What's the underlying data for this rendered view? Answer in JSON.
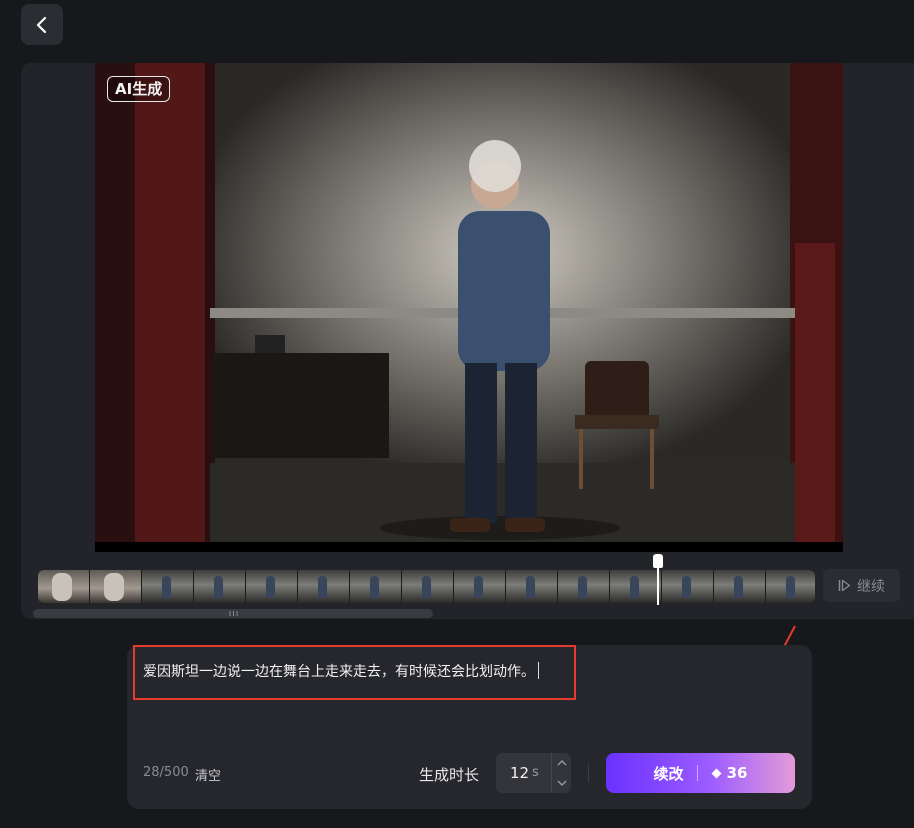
{
  "video": {
    "badge": "AI生成"
  },
  "timeline": {
    "frame_count": 15,
    "continue_label": "继续"
  },
  "prompt": {
    "text": "爱因斯坦一边说一边在舞台上走来走去，有时候还会比划动作。",
    "char_count": "28/500",
    "clear_label": "清空"
  },
  "duration": {
    "label": "生成时长",
    "value": "12",
    "unit": "s"
  },
  "generate": {
    "label": "续改",
    "cost": "36"
  },
  "colors": {
    "highlight_box": "#e53a2e",
    "accent_start": "#6a31ff",
    "accent_end": "#e39bd9"
  }
}
